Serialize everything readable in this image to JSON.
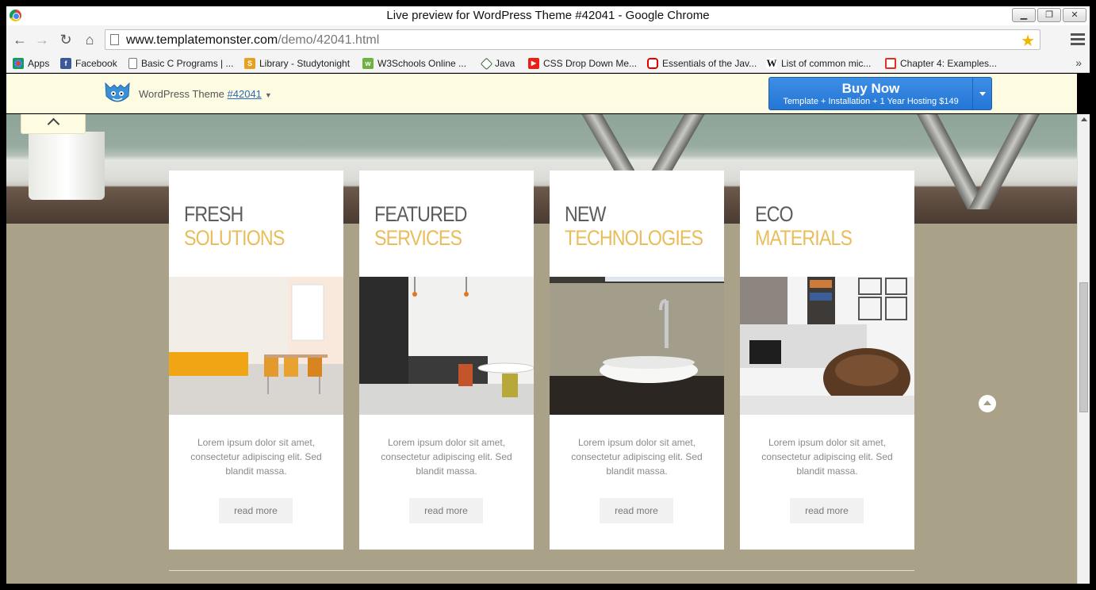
{
  "window": {
    "title": "Live preview for WordPress Theme #42041 - Google Chrome",
    "minimize": "▁",
    "restore": "❐",
    "close": "✕"
  },
  "nav": {
    "back": "←",
    "forward": "→",
    "reload": "↻",
    "home": "⌂",
    "url_host": "www.templatemonster.com",
    "url_path": "/demo/42041.html",
    "star": "★"
  },
  "bookmarks": [
    {
      "label": "Apps",
      "icon": "apps-grid-icon",
      "color": "#d34836"
    },
    {
      "label": "Facebook",
      "icon": "facebook-icon",
      "color": "#3b5998"
    },
    {
      "label": "Basic C Programs | ...",
      "icon": "page-icon",
      "color": "#ffffff"
    },
    {
      "label": "Library - Studytonight",
      "icon": "studytonight-icon",
      "color": "#e8a020"
    },
    {
      "label": "W3Schools Online ...",
      "icon": "w3schools-icon",
      "color": "#6db33f"
    },
    {
      "label": "Java",
      "icon": "java-icon",
      "color": "#5a8a5a"
    },
    {
      "label": "CSS Drop Down Me...",
      "icon": "youtube-icon",
      "color": "#e62117"
    },
    {
      "label": "Essentials of the Jav...",
      "icon": "oracle-icon",
      "color": "#e00000"
    },
    {
      "label": "List of common mic...",
      "icon": "wikipedia-icon",
      "color": "#ffffff"
    },
    {
      "label": "Chapter 4: Examples...",
      "icon": "chapter-icon",
      "color": "#e03020"
    }
  ],
  "bookmarks_more": "»",
  "tm_bar": {
    "theme_label": "WordPress Theme",
    "theme_number": "#42041",
    "buy_label": "Buy Now",
    "buy_sub": "Template + Installation + 1 Year Hosting $149"
  },
  "cards": [
    {
      "line1": "FRESH",
      "line2": "SOLUTIONS",
      "desc": "Lorem ipsum dolor sit amet, consectetur adipiscing elit. Sed blandit massa.",
      "button": "read more",
      "image": "dining-room-photo"
    },
    {
      "line1": "FEATURED",
      "line2": "SERVICES",
      "desc": "Lorem ipsum dolor sit amet, consectetur adipiscing elit. Sed blandit massa.",
      "button": "read more",
      "image": "kitchen-photo"
    },
    {
      "line1": "NEW",
      "line2": "TECHNOLOGIES",
      "desc": "Lorem ipsum dolor sit amet, consectetur adipiscing elit. Sed blandit massa.",
      "button": "read more",
      "image": "bathroom-sink-photo"
    },
    {
      "line1": "ECO",
      "line2": "MATERIALS",
      "desc": "Lorem ipsum dolor sit amet, consectetur adipiscing elit. Sed blandit massa.",
      "button": "read more",
      "image": "living-room-photo"
    }
  ],
  "colors": {
    "accent": "#e9bd5a",
    "page_bg": "#aaa288",
    "buy_button": "#2476d6",
    "tm_bar_bg": "#fdfbe2"
  }
}
